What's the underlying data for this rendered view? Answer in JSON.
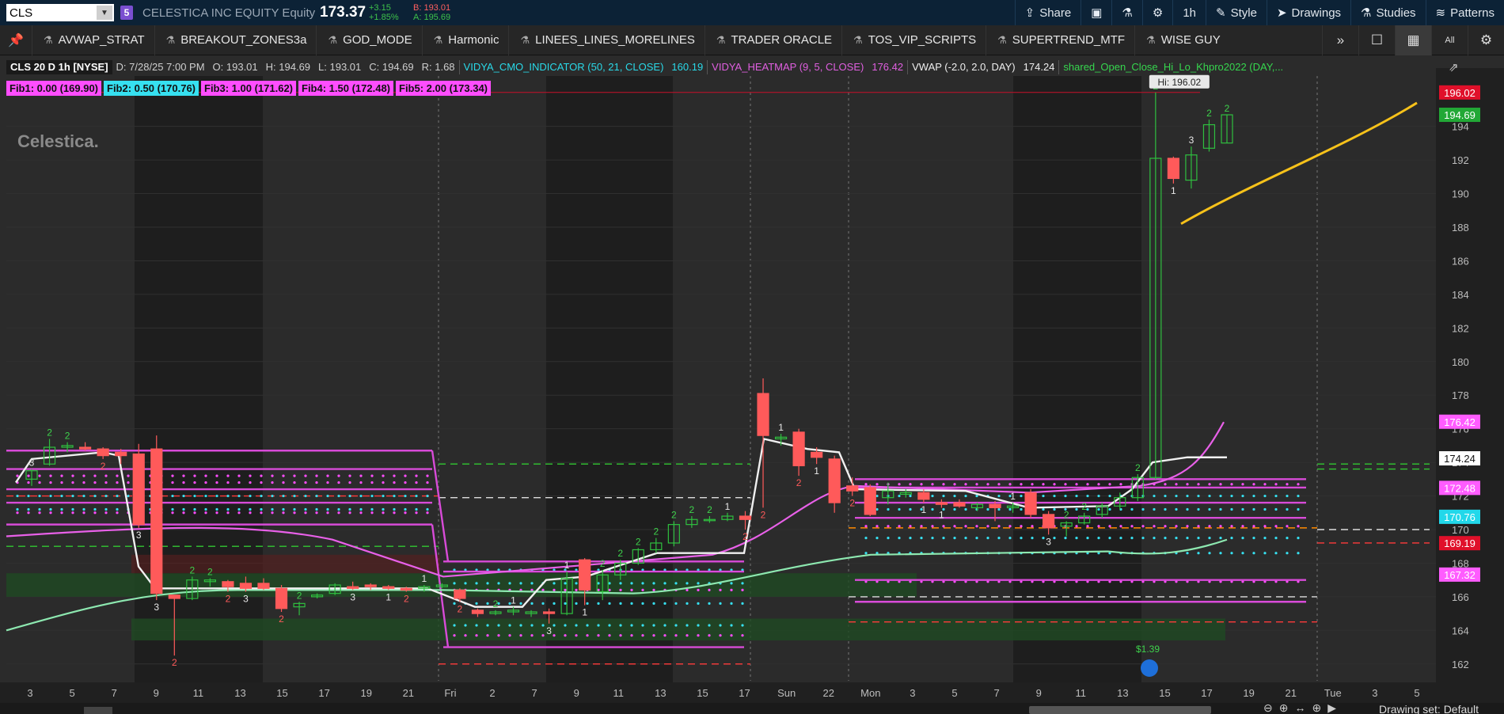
{
  "topbar": {
    "symbol_value": "CLS",
    "link_badge": "5",
    "description": "CELESTICA INC EQUITY Equity",
    "last_price": "173.37",
    "change": "+3.15",
    "change_pct": "+1.85%",
    "bid": "B: 193.01",
    "ask": "A: 195.69",
    "buttons": [
      {
        "label": "Share",
        "icon": "share-icon"
      },
      {
        "label": "",
        "icon": "screenshot-icon"
      },
      {
        "label": "",
        "icon": "flask-icon"
      },
      {
        "label": "",
        "icon": "gear-icon"
      },
      {
        "label": "1h",
        "icon": ""
      },
      {
        "label": "Style",
        "icon": "style-icon"
      },
      {
        "label": "Drawings",
        "icon": "cursor-icon"
      },
      {
        "label": "Studies",
        "icon": "flask-icon"
      },
      {
        "label": "Patterns",
        "icon": "patterns-icon"
      }
    ]
  },
  "studybar": {
    "items": [
      "AVWAP_STRAT",
      "BREAKOUT_ZONES3a",
      "GOD_MODE",
      "Harmonic",
      "LINEES_LINES_MORELINES",
      "TRADER ORACLE",
      "TOS_VIP_SCRIPTS",
      "SUPERTREND_MTF",
      "WISE GUY"
    ],
    "more": "»",
    "right_icons": [
      "single-layout-icon",
      "grid-layout-icon",
      "all-icon",
      "gear-icon"
    ],
    "all_label": "All"
  },
  "header": {
    "symbol": "CLS 20 D 1h [NYSE]",
    "date": "D: 7/28/25 7:00 PM",
    "open": "O: 193.01",
    "high": "H: 194.69",
    "low": "L: 193.01",
    "close": "C: 194.69",
    "range": "R: 1.68",
    "vidya_cmo_label": "VIDYA_CMO_INDICATOR (50, 21, CLOSE)",
    "vidya_cmo_value": "160.19",
    "vidya_heat_label": "VIDYA_HEATMAP (9, 5, CLOSE)",
    "vidya_heat_value": "176.42",
    "vwap_label": "VWAP (-2.0, 2.0, DAY)",
    "vwap_value": "174.24",
    "shared_label": "shared_Open_Close_Hi_Lo_Khpro2022 (DAY,..."
  },
  "fibs": [
    {
      "label": "Fib1: 0.00 (169.90)",
      "color": "#ff4dff"
    },
    {
      "label": "Fib2: 0.50 (170.76)",
      "color": "#36e0f0"
    },
    {
      "label": "Fib3: 1.00 (171.62)",
      "color": "#ff4dff"
    },
    {
      "label": "Fib4: 1.50 (172.48)",
      "color": "#ff4dff"
    },
    {
      "label": "Fib5: 2.00 (173.34)",
      "color": "#ff4dff"
    }
  ],
  "watermark": "Celestica.",
  "chart_data": {
    "type": "candlestick",
    "timeframe": "1h",
    "ylim": [
      161,
      197
    ],
    "y_ticks": [
      162,
      164,
      166,
      168,
      170,
      172,
      174,
      176,
      178,
      180,
      182,
      184,
      186,
      188,
      190,
      192,
      194
    ],
    "x_ticks": [
      "3",
      "5",
      "7",
      "9",
      "11",
      "13",
      "15",
      "17",
      "19",
      "21",
      "Fri",
      "2",
      "7",
      "9",
      "11",
      "13",
      "15",
      "17",
      "Sun",
      "22",
      "Mon",
      "3",
      "5",
      "7",
      "9",
      "11",
      "13",
      "15",
      "17",
      "19",
      "21",
      "Tue",
      "3",
      "5"
    ],
    "price_labels": [
      {
        "text": "196.02",
        "value": 196.02,
        "color": "#e0102a"
      },
      {
        "text": "194.69",
        "value": 194.69,
        "color": "#22a836"
      },
      {
        "text": "176.42",
        "value": 176.42,
        "color": "#ff5cff"
      },
      {
        "text": "174.24",
        "value": 174.24,
        "color": "#ffffff"
      },
      {
        "text": "172.48",
        "value": 172.48,
        "color": "#ff5cff"
      },
      {
        "text": "170.76",
        "value": 170.76,
        "color": "#22d8ea"
      },
      {
        "text": "169.19",
        "value": 169.19,
        "color": "#e0102a"
      },
      {
        "text": "167.32",
        "value": 167.32,
        "color": "#ff5cff"
      }
    ],
    "hi_label": "Hi: 196.02",
    "dividend_label": "$1.39",
    "candles": [
      {
        "o": 173.0,
        "h": 173.6,
        "l": 172.6,
        "c": 173.5
      },
      {
        "o": 173.9,
        "h": 175.4,
        "l": 173.8,
        "c": 174.9
      },
      {
        "o": 174.9,
        "h": 175.2,
        "l": 174.6,
        "c": 175.0
      },
      {
        "o": 174.9,
        "h": 175.2,
        "l": 174.7,
        "c": 174.8
      },
      {
        "o": 174.8,
        "h": 174.9,
        "l": 174.2,
        "c": 174.4
      },
      {
        "o": 174.6,
        "h": 174.8,
        "l": 173.9,
        "c": 174.4
      },
      {
        "o": 174.5,
        "h": 175.1,
        "l": 170.1,
        "c": 170.3
      },
      {
        "o": 174.8,
        "h": 175.6,
        "l": 165.8,
        "c": 166.2
      },
      {
        "o": 166.1,
        "h": 166.1,
        "l": 162.5,
        "c": 165.9
      },
      {
        "o": 165.9,
        "h": 167.2,
        "l": 165.8,
        "c": 167.0
      },
      {
        "o": 166.9,
        "h": 167.1,
        "l": 166.6,
        "c": 167.0
      },
      {
        "o": 166.9,
        "h": 167.0,
        "l": 166.3,
        "c": 166.6
      },
      {
        "o": 166.8,
        "h": 167.2,
        "l": 166.3,
        "c": 166.5
      },
      {
        "o": 166.8,
        "h": 167.1,
        "l": 166.4,
        "c": 166.5
      },
      {
        "o": 166.5,
        "h": 166.7,
        "l": 165.1,
        "c": 165.3
      },
      {
        "o": 165.4,
        "h": 165.7,
        "l": 164.9,
        "c": 165.6
      },
      {
        "o": 166.0,
        "h": 166.2,
        "l": 165.9,
        "c": 166.1
      },
      {
        "o": 166.2,
        "h": 166.8,
        "l": 166.1,
        "c": 166.7
      },
      {
        "o": 166.6,
        "h": 166.9,
        "l": 166.4,
        "c": 166.5
      },
      {
        "o": 166.7,
        "h": 166.8,
        "l": 166.4,
        "c": 166.6
      },
      {
        "o": 166.6,
        "h": 166.7,
        "l": 166.4,
        "c": 166.5
      },
      {
        "o": 166.5,
        "h": 166.6,
        "l": 166.3,
        "c": 166.4
      },
      {
        "o": 166.5,
        "h": 166.7,
        "l": 166.3,
        "c": 166.6
      },
      {
        "o": 166.6,
        "h": 166.8,
        "l": 166.5,
        "c": 166.7
      },
      {
        "o": 166.4,
        "h": 166.5,
        "l": 165.7,
        "c": 165.9
      },
      {
        "o": 165.2,
        "h": 165.3,
        "l": 164.8,
        "c": 165.0
      },
      {
        "o": 165.0,
        "h": 165.2,
        "l": 164.9,
        "c": 165.1
      },
      {
        "o": 165.1,
        "h": 165.4,
        "l": 164.9,
        "c": 165.2
      },
      {
        "o": 165.0,
        "h": 165.2,
        "l": 164.8,
        "c": 165.1
      },
      {
        "o": 165.1,
        "h": 165.3,
        "l": 164.4,
        "c": 165.0
      },
      {
        "o": 165.0,
        "h": 167.5,
        "l": 164.9,
        "c": 167.1
      },
      {
        "o": 168.2,
        "h": 168.3,
        "l": 165.5,
        "c": 166.4
      },
      {
        "o": 166.3,
        "h": 167.6,
        "l": 165.8,
        "c": 167.3
      },
      {
        "o": 167.3,
        "h": 168.2,
        "l": 167.0,
        "c": 168.0
      },
      {
        "o": 168.0,
        "h": 168.9,
        "l": 167.9,
        "c": 168.8
      },
      {
        "o": 168.8,
        "h": 169.5,
        "l": 168.6,
        "c": 169.2
      },
      {
        "o": 169.2,
        "h": 170.5,
        "l": 169.0,
        "c": 170.3
      },
      {
        "o": 170.3,
        "h": 170.8,
        "l": 170.1,
        "c": 170.6
      },
      {
        "o": 170.6,
        "h": 170.8,
        "l": 170.4,
        "c": 170.6
      },
      {
        "o": 170.6,
        "h": 171.0,
        "l": 170.5,
        "c": 170.8
      },
      {
        "o": 170.8,
        "h": 171.1,
        "l": 170.0,
        "c": 170.6
      },
      {
        "o": 178.1,
        "h": 179.0,
        "l": 171.3,
        "c": 175.6
      },
      {
        "o": 175.4,
        "h": 175.7,
        "l": 175.0,
        "c": 175.5
      },
      {
        "o": 175.8,
        "h": 176.0,
        "l": 173.2,
        "c": 173.8
      },
      {
        "o": 174.6,
        "h": 174.9,
        "l": 173.9,
        "c": 174.3
      },
      {
        "o": 174.2,
        "h": 174.4,
        "l": 171.0,
        "c": 171.6
      },
      {
        "o": 172.6,
        "h": 173.1,
        "l": 172.0,
        "c": 172.3
      },
      {
        "o": 172.5,
        "h": 172.7,
        "l": 170.8,
        "c": 170.9
      },
      {
        "o": 171.9,
        "h": 172.8,
        "l": 171.5,
        "c": 172.3
      },
      {
        "o": 172.1,
        "h": 172.4,
        "l": 171.9,
        "c": 172.2
      },
      {
        "o": 172.2,
        "h": 172.4,
        "l": 171.6,
        "c": 171.8
      },
      {
        "o": 171.6,
        "h": 171.8,
        "l": 171.3,
        "c": 171.5
      },
      {
        "o": 171.6,
        "h": 171.8,
        "l": 171.3,
        "c": 171.4
      },
      {
        "o": 171.3,
        "h": 171.6,
        "l": 171.1,
        "c": 171.5
      },
      {
        "o": 171.5,
        "h": 171.7,
        "l": 170.5,
        "c": 171.3
      },
      {
        "o": 171.3,
        "h": 171.6,
        "l": 171.0,
        "c": 171.4
      },
      {
        "o": 172.2,
        "h": 172.4,
        "l": 170.7,
        "c": 170.9
      },
      {
        "o": 170.9,
        "h": 171.1,
        "l": 169.7,
        "c": 170.1
      },
      {
        "o": 170.2,
        "h": 170.5,
        "l": 169.6,
        "c": 170.4
      },
      {
        "o": 170.4,
        "h": 171.0,
        "l": 170.3,
        "c": 170.8
      },
      {
        "o": 170.9,
        "h": 171.6,
        "l": 170.7,
        "c": 171.4
      },
      {
        "o": 171.4,
        "h": 172.2,
        "l": 171.2,
        "c": 171.9
      },
      {
        "o": 171.9,
        "h": 173.3,
        "l": 171.7,
        "c": 173.1
      },
      {
        "o": 173.1,
        "h": 196.02,
        "l": 173.0,
        "c": 192.1
      },
      {
        "o": 192.1,
        "h": 192.2,
        "l": 190.6,
        "c": 190.9
      },
      {
        "o": 190.8,
        "h": 192.8,
        "l": 190.3,
        "c": 192.3
      },
      {
        "o": 192.7,
        "h": 194.4,
        "l": 192.5,
        "c": 194.1
      },
      {
        "o": 193.01,
        "h": 194.69,
        "l": 193.01,
        "c": 194.69
      }
    ],
    "candle_labels": [
      "3",
      "2",
      "2",
      "",
      "2",
      "",
      "3",
      "3",
      "2",
      "2",
      "2",
      "2",
      "3",
      "",
      "2",
      "2",
      "",
      "",
      "3",
      "",
      "1",
      "2",
      "1",
      "",
      "2",
      "",
      "2",
      "1",
      "",
      "3",
      "1",
      "1",
      "2",
      "2",
      "2",
      "2",
      "2",
      "2",
      "2",
      "1",
      "2",
      "2",
      "1",
      "2",
      "1",
      "",
      "2",
      "",
      "",
      "",
      "1",
      "1",
      "",
      "",
      "",
      "1",
      "",
      "3",
      "2",
      "2",
      "",
      "",
      "2",
      "2",
      "1",
      "3",
      "2",
      "2"
    ]
  }
}
